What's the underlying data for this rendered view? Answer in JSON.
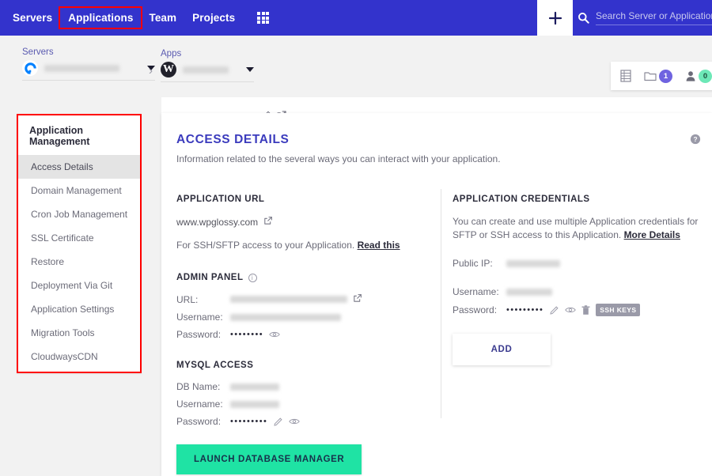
{
  "topnav": {
    "links": [
      {
        "label": "Servers",
        "highlighted": false
      },
      {
        "label": "Applications",
        "highlighted": true
      },
      {
        "label": "Team",
        "highlighted": false
      },
      {
        "label": "Projects",
        "highlighted": false
      }
    ],
    "grid_icon": "apps-grid-icon",
    "plus_label": "+",
    "search_icon": "search-icon",
    "search_placeholder": "Search Server or Application",
    "search_value": "",
    "brand_color": "#3333cc",
    "annotation_color": "#ff0000"
  },
  "breadcrumb": {
    "servers_label": "Servers",
    "server_name": "",
    "server_icon": "digitalocean-logo-icon",
    "apps_label": "Apps",
    "app_name": "",
    "app_icon": "wordpress-logo-icon",
    "edit_icon": "pencil-icon",
    "open_icon": "external-link-icon",
    "separator_icon": "chevron-right-icon"
  },
  "mini_panel": {
    "items": [
      {
        "icon": "server-list-icon",
        "badge": null
      },
      {
        "icon": "folder-icon",
        "badge": "1",
        "badge_color": "#6f63e0"
      },
      {
        "icon": "user-icon",
        "badge": "0",
        "badge_color": "#6de8b7"
      }
    ]
  },
  "sidebar": {
    "title": "Application Management",
    "items": [
      {
        "label": "Access Details",
        "active": true
      },
      {
        "label": "Domain Management",
        "active": false
      },
      {
        "label": "Cron Job Management",
        "active": false
      },
      {
        "label": "SSL Certificate",
        "active": false
      },
      {
        "label": "Restore",
        "active": false
      },
      {
        "label": "Deployment Via Git",
        "active": false
      },
      {
        "label": "Application Settings",
        "active": false
      },
      {
        "label": "Migration Tools",
        "active": false
      },
      {
        "label": "CloudwaysCDN",
        "active": false
      }
    ]
  },
  "main": {
    "title": "ACCESS DETAILS",
    "subtitle": "Information related to the several ways you can interact with your application.",
    "help_icon": "help-circle-icon",
    "application_url": {
      "heading": "APPLICATION URL",
      "url": "www.wpglossy.com",
      "external_icon": "external-link-icon",
      "note_prefix": "For SSH/SFTP access to your Application.",
      "note_link": "Read this"
    },
    "admin_panel": {
      "heading": "ADMIN PANEL",
      "info_icon": "info-circle-icon",
      "rows": [
        {
          "key": "URL:",
          "value": "",
          "redacted": true,
          "redacted_width": 148,
          "icons": [
            "external-link-icon"
          ]
        },
        {
          "key": "Username:",
          "value": "",
          "redacted": true,
          "redacted_width": 140,
          "icons": []
        },
        {
          "key": "Password:",
          "value": "••••••••",
          "redacted": false,
          "icons": [
            "eye-icon"
          ]
        }
      ]
    },
    "mysql_access": {
      "heading": "MYSQL ACCESS",
      "rows": [
        {
          "key": "DB Name:",
          "value": "",
          "redacted": true,
          "redacted_width": 62,
          "icons": []
        },
        {
          "key": "Username:",
          "value": "",
          "redacted": true,
          "redacted_width": 62,
          "icons": []
        },
        {
          "key": "Password:",
          "value": "•••••••••",
          "redacted": false,
          "icons": [
            "pencil-icon",
            "eye-icon"
          ]
        }
      ],
      "launch_button": "LAUNCH DATABASE MANAGER",
      "launch_color": "#1fe3a4"
    },
    "application_credentials": {
      "heading": "APPLICATION CREDENTIALS",
      "description_prefix": "You can create and use multiple Application credentials for SFTP or SSH access to this Application.",
      "description_link": "More Details",
      "rows": [
        {
          "key": "Public IP:",
          "value": "",
          "redacted": true,
          "redacted_width": 68,
          "icons": []
        },
        {
          "key": "Username:",
          "value": "",
          "redacted": true,
          "redacted_width": 58,
          "icons": []
        },
        {
          "key": "Password:",
          "value": "•••••••••",
          "redacted": false,
          "icons": [
            "pencil-icon",
            "eye-icon",
            "trash-icon"
          ],
          "badge": "SSH KEYS"
        }
      ],
      "add_button": "ADD"
    }
  }
}
